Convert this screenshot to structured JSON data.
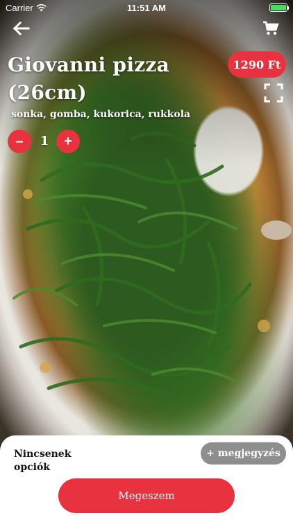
{
  "status_bar": {
    "carrier": "Carrier",
    "time": "11:51 AM",
    "battery_level": 1.0
  },
  "nav": {
    "back_icon": "arrow-left-icon",
    "cart_icon": "cart-icon",
    "fullscreen_icon": "fullscreen-icon"
  },
  "product": {
    "title": "Giovanni pizza (26cm)",
    "ingredients": "sonka, gomba, kukorica, rukkola",
    "price": "1290 Ft",
    "quantity": "1",
    "minus_label": "–",
    "plus_label": "+"
  },
  "bottom": {
    "options_label": "Nincsenek opciók",
    "note_button": "+ megjegyzés",
    "order_button": "Megeszem"
  },
  "colors": {
    "accent": "#e8323f",
    "note_button": "#8e8e8e"
  }
}
